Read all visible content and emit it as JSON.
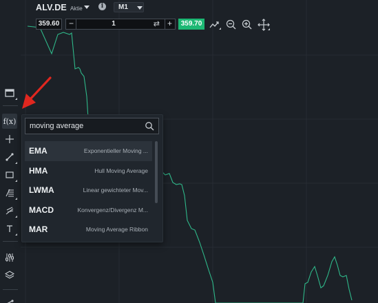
{
  "header": {
    "symbol": "ALV.DE",
    "asset_type": "Aktie",
    "timeframe": "M1"
  },
  "trade_bar": {
    "sell_price": "359.60",
    "quantity": "1",
    "buy_price": "359.70",
    "minus_label": "−",
    "plus_label": "+"
  },
  "sidebar": {
    "fx_label": "f(x)"
  },
  "indicator_search": {
    "query": "moving average",
    "results": [
      {
        "code": "EMA",
        "description": "Exponentieller Moving ..."
      },
      {
        "code": "HMA",
        "description": "Hull Moving Average"
      },
      {
        "code": "LWMA",
        "description": "Linear gewichteter Mov..."
      },
      {
        "code": "MACD",
        "description": "Konvergenz/Divergenz M..."
      },
      {
        "code": "MAR",
        "description": "Moving Average Ribbon"
      }
    ]
  },
  "colors": {
    "background": "#1c2127",
    "grid": "#262c33",
    "price_line": "#2fb98a",
    "buy": "#1db874",
    "arrow": "#e0271f"
  }
}
